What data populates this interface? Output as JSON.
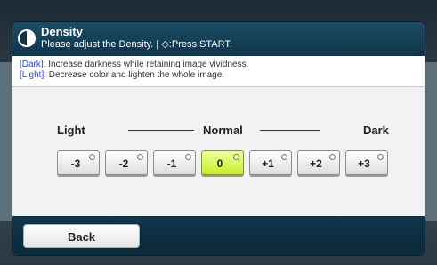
{
  "header": {
    "title": "Density",
    "subtitle": "Please adjust the Density. | ◇:Press START."
  },
  "info": {
    "dark_tag": "[Dark]",
    "dark_text": ": Increase darkness while retaining image vividness.",
    "light_tag": "[Light]",
    "light_text": ": Decrease color and lighten the whole image."
  },
  "scale": {
    "light_label": "Light",
    "normal_label": "Normal",
    "dark_label": "Dark"
  },
  "levels": [
    {
      "label": "-3",
      "selected": false
    },
    {
      "label": "-2",
      "selected": false
    },
    {
      "label": "-1",
      "selected": false
    },
    {
      "label": "0",
      "selected": true
    },
    {
      "label": "+1",
      "selected": false
    },
    {
      "label": "+2",
      "selected": false
    },
    {
      "label": "+3",
      "selected": false
    }
  ],
  "footer": {
    "back_label": "Back"
  },
  "colors": {
    "header_bg": "#0f3449",
    "selected_button": "#c7ee2b",
    "info_tag": "#2d4fd0"
  },
  "icons": {
    "density": "density-icon",
    "start": "start-icon"
  }
}
